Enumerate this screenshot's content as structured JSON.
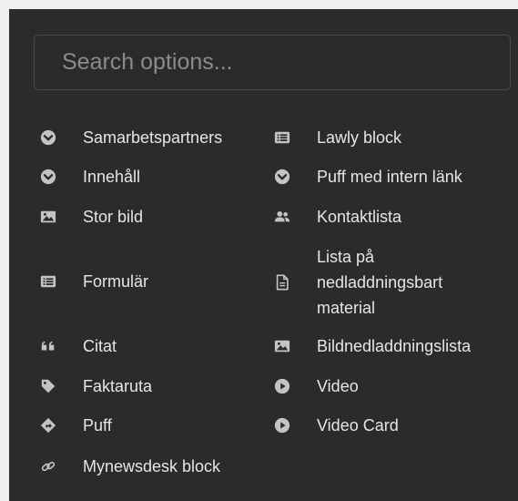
{
  "search": {
    "placeholder": "Search options...",
    "value": ""
  },
  "options_left": [
    {
      "label": "Samarbetspartners",
      "icon": "chevron-circle-down-icon"
    },
    {
      "label": "Innehåll",
      "icon": "chevron-circle-down-icon"
    },
    {
      "label": "Stor bild",
      "icon": "image-icon"
    },
    {
      "label": "Formulär",
      "icon": "list-alt-icon"
    },
    {
      "label": "Citat",
      "icon": "quote-icon"
    },
    {
      "label": "Faktaruta",
      "icon": "tag-icon"
    },
    {
      "label": "Puff",
      "icon": "directions-diamond-icon"
    },
    {
      "label": "Mynewsdesk block",
      "icon": "link-icon"
    }
  ],
  "options_right": [
    {
      "label": "Lawly block",
      "icon": "list-alt-icon"
    },
    {
      "label": "Puff med intern länk",
      "icon": "chevron-circle-down-icon"
    },
    {
      "label": "Kontaktlista",
      "icon": "users-icon"
    },
    {
      "label": "Lista på nedladdningsbart material",
      "icon": "document-icon"
    },
    {
      "label": "Bildnedladdningslista",
      "icon": "image-icon"
    },
    {
      "label": "Video",
      "icon": "play-circle-icon"
    },
    {
      "label": "Video Card",
      "icon": "play-circle-icon"
    }
  ]
}
